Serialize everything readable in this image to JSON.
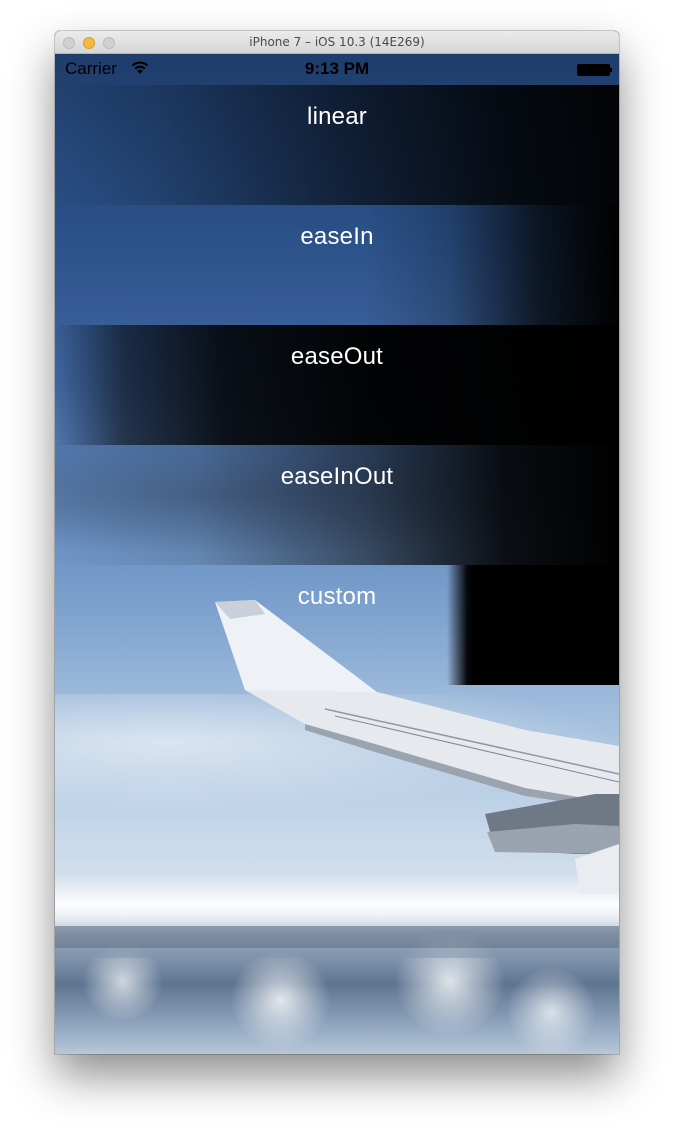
{
  "window": {
    "title": "iPhone 7 – iOS 10.3 (14E269)"
  },
  "statusbar": {
    "carrier": "Carrier",
    "time": "9:13 PM",
    "wifi_icon": "wifi-icon",
    "battery_icon": "battery-icon"
  },
  "rows": [
    {
      "label": "linear"
    },
    {
      "label": "easeIn"
    },
    {
      "label": "easeOut"
    },
    {
      "label": "easeInOut"
    },
    {
      "label": "custom"
    }
  ],
  "colors": {
    "row_text": "#ffffff",
    "overlay": "#000000",
    "sky_top": "#1f3d6b",
    "sky_mid": "#7ea3cf",
    "titlebar": "#e3e3e3"
  }
}
